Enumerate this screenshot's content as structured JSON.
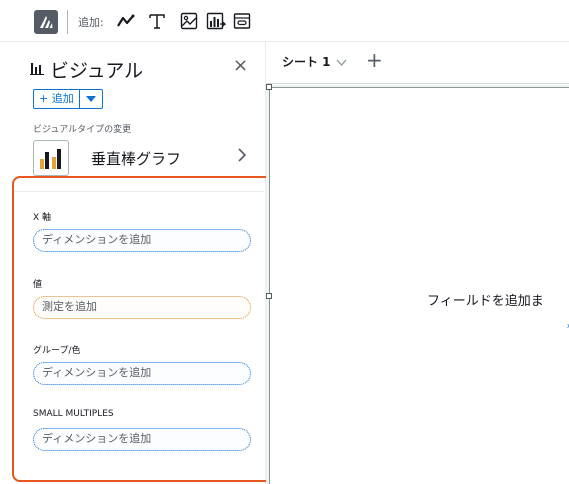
{
  "toolbar": {
    "add_label": "追加:",
    "tools": [
      {
        "icon": "line-chart-icon"
      },
      {
        "icon": "text-icon"
      },
      {
        "icon": "image-icon"
      },
      {
        "icon": "insight-icon"
      },
      {
        "icon": "embed-icon"
      }
    ]
  },
  "panel": {
    "title": "ビジュアル",
    "close": "×",
    "add_button": "+ 追加",
    "visual_type_label": "ビジュアルタイプの変更",
    "visual_type_name": "垂直棒グラフ",
    "wells": [
      {
        "label": "X 軸",
        "placeholder": "ディメンションを追加",
        "kind": "dimension"
      },
      {
        "label": "値",
        "placeholder": "測定を追加",
        "kind": "measure"
      },
      {
        "label": "グループ/色",
        "placeholder": "ディメンションを追加",
        "kind": "dimension"
      },
      {
        "label": "SMALL MULTIPLES",
        "placeholder": "ディメンションを追加",
        "kind": "dimension"
      }
    ]
  },
  "sheet": {
    "tab_label": "シート 1",
    "add": "+"
  },
  "canvas": {
    "empty_message": "フィールドを追加ま",
    "small_mark": "x"
  },
  "colors": {
    "accent": "#0972d3",
    "highlight": "#e8551f",
    "measure": "#d98b29"
  }
}
